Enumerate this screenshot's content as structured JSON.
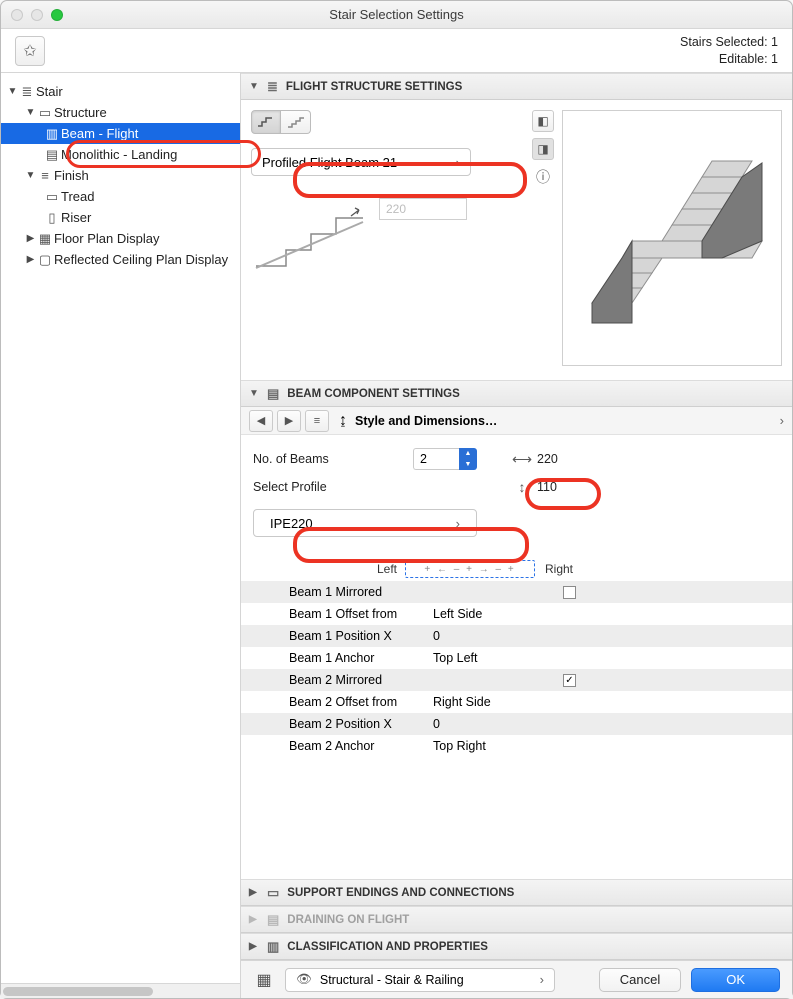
{
  "window": {
    "title": "Stair Selection Settings"
  },
  "status": {
    "selected": "Stairs Selected: 1",
    "editable": "Editable: 1"
  },
  "tree": {
    "root": "Stair",
    "structure": "Structure",
    "beam_flight": "Beam - Flight",
    "monolithic": "Monolithic - Landing",
    "finish": "Finish",
    "tread": "Tread",
    "riser": "Riser",
    "floor_plan": "Floor Plan Display",
    "rcp": "Reflected Ceiling Plan Display"
  },
  "panels": {
    "flight": "FLIGHT STRUCTURE SETTINGS",
    "beam": "BEAM COMPONENT SETTINGS",
    "support": "SUPPORT ENDINGS AND CONNECTIONS",
    "drain": "DRAINING ON FLIGHT",
    "classif": "CLASSIFICATION AND PROPERTIES"
  },
  "flight": {
    "profile": "Profiled Flight Beam 21",
    "dim_value": "220"
  },
  "beam": {
    "nav_label": "Style and Dimensions…",
    "no_label": "No. of Beams",
    "no_value": "2",
    "width": "220",
    "height": "110",
    "select_profile_label": "Select Profile",
    "ipe": "IPE220",
    "left": "Left",
    "right": "Right",
    "rows": [
      {
        "label": "Beam 1 Mirrored",
        "value": "",
        "chk": false,
        "withChk": true
      },
      {
        "label": "Beam 1 Offset from",
        "value": "Left Side"
      },
      {
        "label": "Beam 1 Position X",
        "value": "0"
      },
      {
        "label": "Beam 1 Anchor",
        "value": "Top Left"
      },
      {
        "label": "Beam 2 Mirrored",
        "value": "",
        "chk": true,
        "withChk": true
      },
      {
        "label": "Beam 2 Offset from",
        "value": "Right Side"
      },
      {
        "label": "Beam 2 Position X",
        "value": "0"
      },
      {
        "label": "Beam 2 Anchor",
        "value": "Top Right"
      }
    ]
  },
  "footer": {
    "layer": "Structural - Stair & Railing",
    "cancel": "Cancel",
    "ok": "OK"
  }
}
